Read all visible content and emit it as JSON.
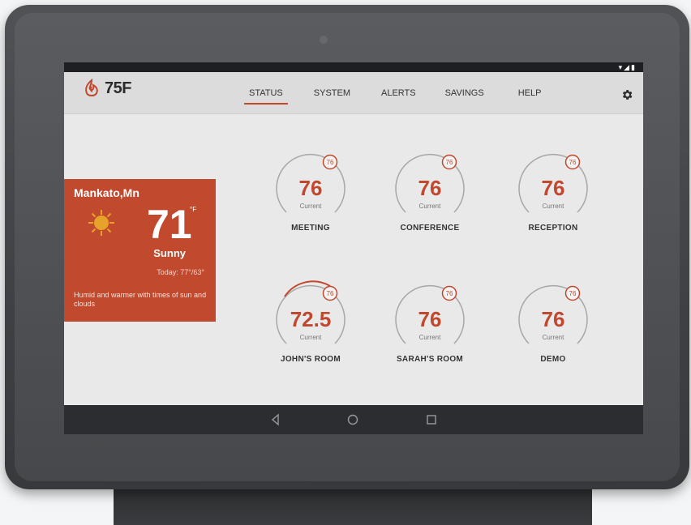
{
  "app": {
    "logo_text": "75F"
  },
  "statusbar": {
    "icons": "▾◢▮"
  },
  "tabs": [
    {
      "label": "STATUS",
      "active": true
    },
    {
      "label": "SYSTEM",
      "active": false
    },
    {
      "label": "ALERTS",
      "active": false
    },
    {
      "label": "SAVINGS",
      "active": false
    },
    {
      "label": "HELP",
      "active": false
    }
  ],
  "weather": {
    "city": "Mankato,Mn",
    "temperature": "71",
    "unit": "°F",
    "condition": "Sunny",
    "today": "Today: 77°/63°",
    "description": "Humid and warmer with times of sun and clouds",
    "icon": "sun-icon"
  },
  "zones": [
    {
      "name": "MEETING",
      "current": "76",
      "current_label": "Current",
      "setpoint": "76"
    },
    {
      "name": "CONFERENCE",
      "current": "76",
      "current_label": "Current",
      "setpoint": "76"
    },
    {
      "name": "RECEPTION",
      "current": "76",
      "current_label": "Current",
      "setpoint": "76"
    },
    {
      "name": "JOHN'S ROOM",
      "current": "72.5",
      "current_label": "Current",
      "setpoint": "76"
    },
    {
      "name": "SARAH'S ROOM",
      "current": "76",
      "current_label": "Current",
      "setpoint": "76"
    },
    {
      "name": "DEMO",
      "current": "76",
      "current_label": "Current",
      "setpoint": "76"
    }
  ],
  "navbar": {
    "icons": [
      "back-icon",
      "home-icon",
      "recents-icon"
    ]
  },
  "colors": {
    "accent": "#c0482e",
    "screen_bg": "#e9e9e9",
    "appbar_bg": "#dcdcdc"
  }
}
